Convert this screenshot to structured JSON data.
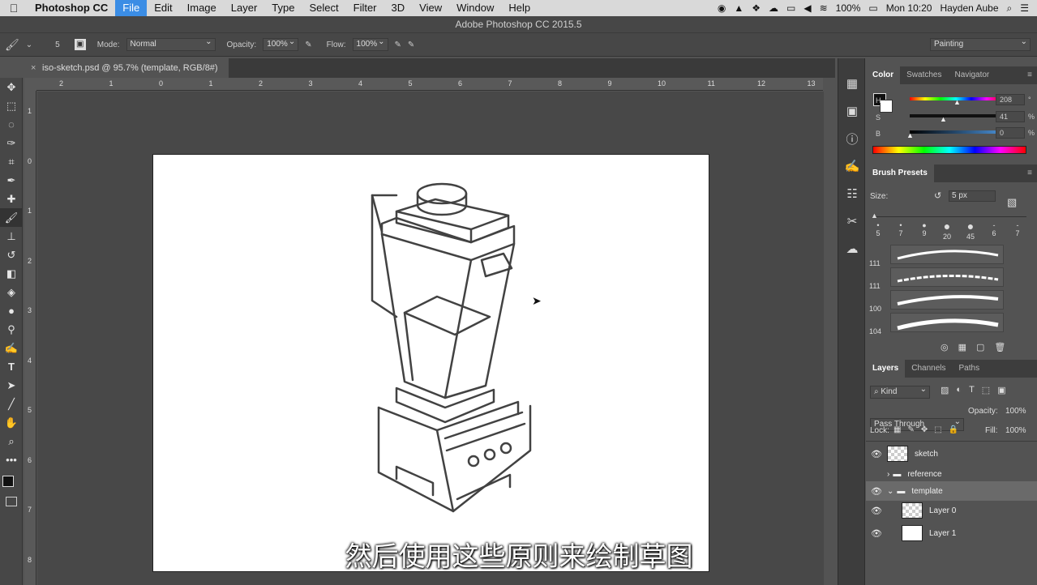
{
  "menubar": {
    "app": "Photoshop CC",
    "items": [
      "File",
      "Edit",
      "Image",
      "Layer",
      "Type",
      "Select",
      "Filter",
      "3D",
      "View",
      "Window",
      "Help"
    ],
    "active": "File",
    "battery": "100%",
    "clock": "Mon 10:20",
    "user": "Hayden Aube"
  },
  "window_title": "Adobe Photoshop CC 2015.5",
  "options": {
    "brush_size": "5",
    "mode_label": "Mode:",
    "mode_value": "Normal",
    "opacity_label": "Opacity:",
    "opacity_value": "100%",
    "flow_label": "Flow:",
    "flow_value": "100%",
    "workspace": "Painting"
  },
  "document_tab": "iso-sketch.psd @ 95.7% (template, RGB/8#)",
  "hruler_ticks": [
    "2",
    "1",
    "0",
    "1",
    "2",
    "3",
    "4",
    "5",
    "6",
    "7",
    "8",
    "9",
    "10",
    "11",
    "12",
    "13"
  ],
  "vruler_ticks": [
    "1",
    "0",
    "1",
    "2",
    "3",
    "4",
    "5",
    "6",
    "7",
    "8"
  ],
  "color_panel": {
    "tabs": [
      "Color",
      "Swatches",
      "Navigator"
    ],
    "h_label": "H",
    "h_value": "208",
    "h_unit": "°",
    "s_label": "S",
    "s_value": "41",
    "s_unit": "%",
    "b_label": "B",
    "b_value": "0",
    "b_unit": "%",
    "h_fraction": 0.58,
    "s_fraction": 0.41,
    "b_fraction": 0.0
  },
  "brush_presets": {
    "tab": "Brush Presets",
    "size_label": "Size:",
    "size_value": "5 px",
    "tips": [
      "5",
      "7",
      "9",
      "20",
      "45",
      "6",
      "7"
    ],
    "stroke_numbers": [
      "111",
      "111",
      "100",
      "104"
    ]
  },
  "layers_panel": {
    "tabs": [
      "Layers",
      "Channels",
      "Paths"
    ],
    "kind": "Kind",
    "blend": "Pass Through",
    "opacity_label": "Opacity:",
    "opacity_value": "100%",
    "lock_label": "Lock:",
    "fill_label": "Fill:",
    "fill_value": "100%",
    "layers": [
      {
        "name": "sketch"
      },
      {
        "name": "reference"
      },
      {
        "name": "template"
      },
      {
        "name": "Layer 0"
      },
      {
        "name": "Layer 1"
      }
    ]
  },
  "subtitle": "然后使用这些原则来绘制草图"
}
